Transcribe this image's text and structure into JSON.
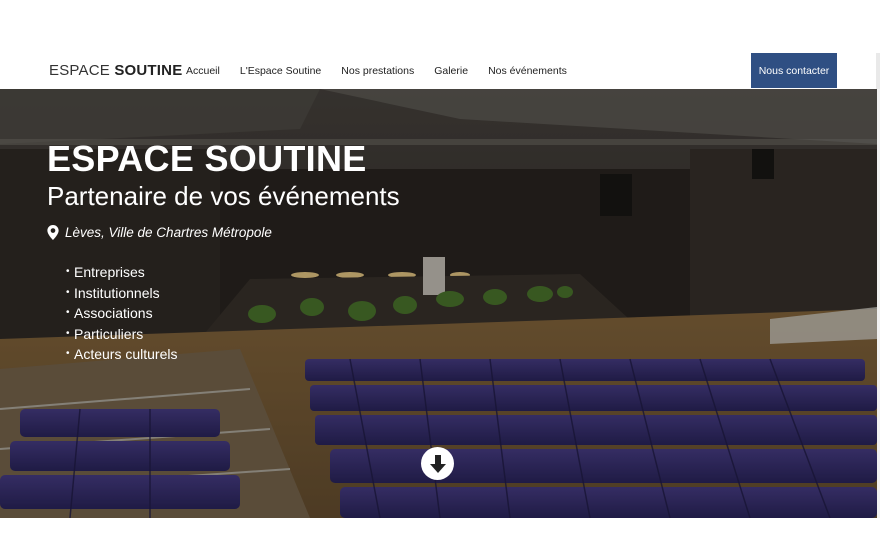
{
  "navbar": {
    "brand_light": "ESPACE",
    "brand_bold": "SOUTINE",
    "links": [
      "Accueil",
      "L'Espace Soutine",
      "Nos prestations",
      "Galerie",
      "Nos événements"
    ],
    "contact_label": "Nous contacter",
    "contact_color": "#2f4f83"
  },
  "hero": {
    "title_light": "ESPACE",
    "title_bold": "SOUTINE",
    "subtitle": "Partenaire de vos événements",
    "location": "Lèves, Ville de Chartres Métropole",
    "audiences": [
      "Entreprises",
      "Institutionnels",
      "Associations",
      "Particuliers",
      "Acteurs culturels"
    ],
    "pin_icon": "map-marker-icon",
    "scroll_icon": "arrow-down-circle-icon"
  }
}
